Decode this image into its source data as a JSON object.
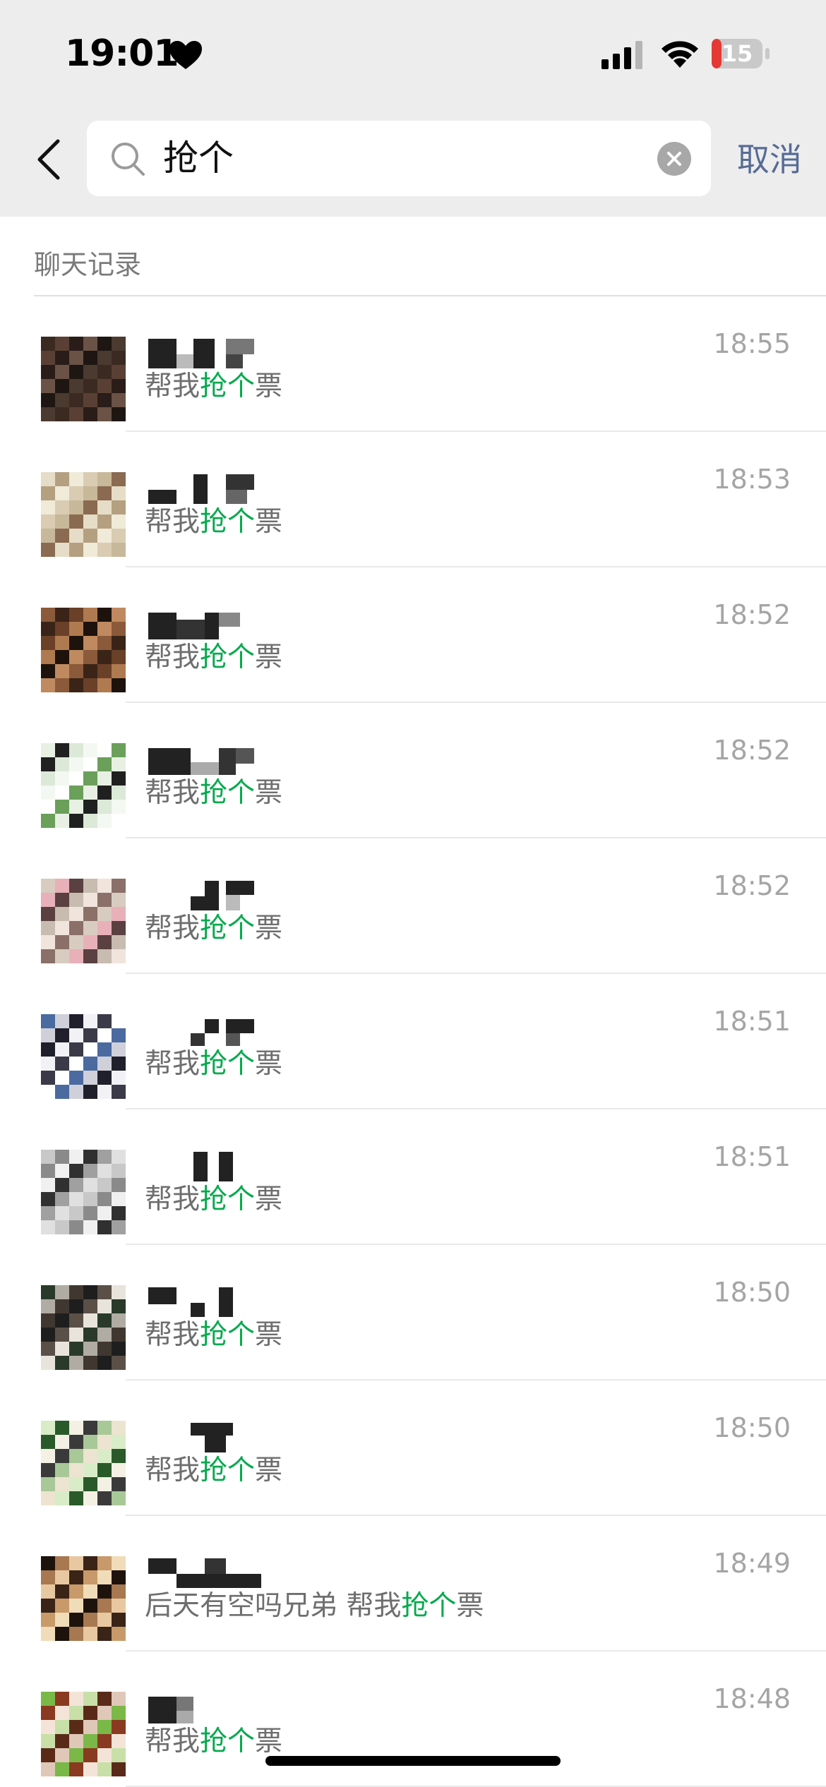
{
  "status_bar": {
    "time": "19:01",
    "battery": "15",
    "accent_battery": "#e53935"
  },
  "search": {
    "query": "抢个",
    "cancel_label": "取消"
  },
  "section": {
    "title": "聊天记录"
  },
  "colors": {
    "highlight": "#07a94e",
    "link": "#576b95",
    "header_bg": "#ededed"
  },
  "results": [
    {
      "time": "18:55",
      "snippet_before": "帮我",
      "keyword": "抢个",
      "snippet_after": "票"
    },
    {
      "time": "18:53",
      "snippet_before": "帮我",
      "keyword": "抢个",
      "snippet_after": "票"
    },
    {
      "time": "18:52",
      "snippet_before": "帮我",
      "keyword": "抢个",
      "snippet_after": "票"
    },
    {
      "time": "18:52",
      "snippet_before": "帮我",
      "keyword": "抢个",
      "snippet_after": "票"
    },
    {
      "time": "18:52",
      "snippet_before": "帮我",
      "keyword": "抢个",
      "snippet_after": "票"
    },
    {
      "time": "18:51",
      "snippet_before": "帮我",
      "keyword": "抢个",
      "snippet_after": "票"
    },
    {
      "time": "18:51",
      "snippet_before": "帮我",
      "keyword": "抢个",
      "snippet_after": "票"
    },
    {
      "time": "18:50",
      "snippet_before": "帮我",
      "keyword": "抢个",
      "snippet_after": "票"
    },
    {
      "time": "18:50",
      "snippet_before": "帮我",
      "keyword": "抢个",
      "snippet_after": "票"
    },
    {
      "time": "18:49",
      "snippet_before": "后天有空吗兄弟 帮我",
      "keyword": "抢个",
      "snippet_after": "票"
    },
    {
      "time": "18:48",
      "snippet_before": "帮我",
      "keyword": "抢个",
      "snippet_after": "票"
    }
  ]
}
